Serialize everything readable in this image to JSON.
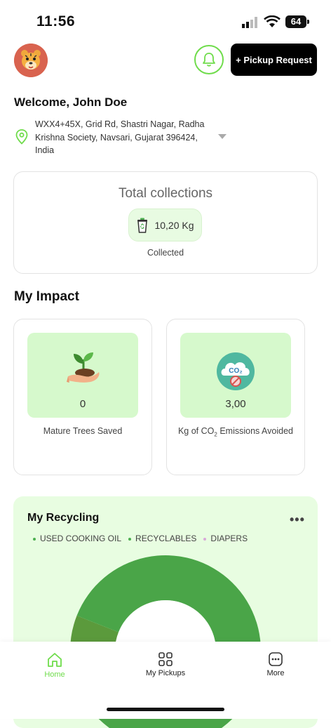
{
  "status_bar": {
    "time": "11:56",
    "battery": "64"
  },
  "header": {
    "pickup_button": "+ Pickup Request"
  },
  "welcome": "Welcome, John Doe",
  "address": "WXX4+45X, Grid Rd, Shastri Nagar, Radha Krishna Society, Navsari, Gujarat 396424, India",
  "total": {
    "title": "Total collections",
    "value": "10,20 Kg",
    "label": "Collected"
  },
  "impact": {
    "title": "My Impact",
    "cards": [
      {
        "value": "0",
        "label": "Mature Trees Saved",
        "icon": "plant-in-hand-icon"
      },
      {
        "value": "3,00",
        "label_pre": "Kg of CO",
        "label_sub": "2",
        "label_post": " Emissions Avoided",
        "icon": "co2-cloud-icon"
      }
    ]
  },
  "recycling": {
    "title": "My Recycling",
    "legend": [
      {
        "label": "USED COOKING OIL",
        "color": "#4caf50"
      },
      {
        "label": "RECYCLABLES",
        "color": "#4caf50"
      },
      {
        "label": "DIAPERS",
        "color": "#d8a9d8"
      }
    ]
  },
  "chart_data": {
    "type": "pie",
    "categories": [
      "USED COOKING OIL",
      "RECYCLABLES",
      "DIAPERS"
    ],
    "values": [
      6,
      94,
      0
    ],
    "colors": [
      "#5b9a3c",
      "#4aa548",
      "#d8a9d8"
    ]
  },
  "nav": [
    {
      "label": "Home",
      "icon": "home-icon",
      "active": true
    },
    {
      "label": "My Pickups",
      "icon": "grid-icon",
      "active": false
    },
    {
      "label": "More",
      "icon": "more-icon",
      "active": false
    }
  ],
  "colors": {
    "accent": "#6fdc4b",
    "card_green": "#d6f9cc"
  }
}
